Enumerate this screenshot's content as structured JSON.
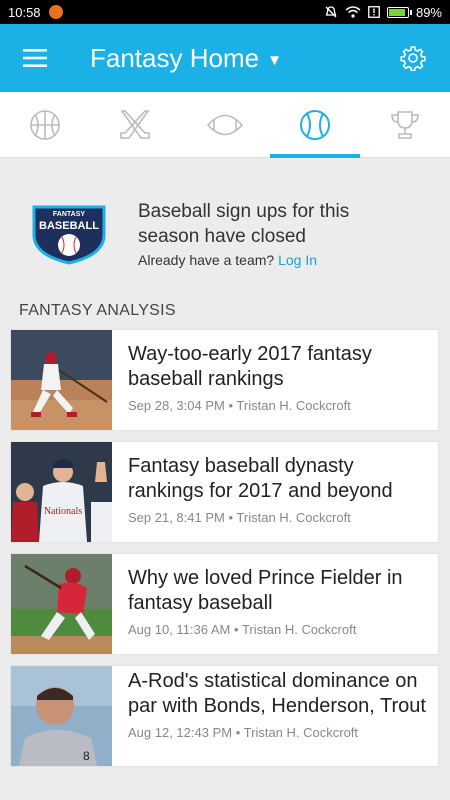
{
  "status_bar": {
    "time": "10:58",
    "battery": "89%",
    "battery_level": 0.89
  },
  "header": {
    "title": "Fantasy Home",
    "menu_icon": "hamburger-menu-icon",
    "settings_icon": "gear-icon"
  },
  "tabs": [
    {
      "icon": "basketball-icon",
      "active": false
    },
    {
      "icon": "hockey-sticks-icon",
      "active": false
    },
    {
      "icon": "football-icon",
      "active": false
    },
    {
      "icon": "baseball-icon",
      "active": true
    },
    {
      "icon": "trophy-icon",
      "active": false
    }
  ],
  "signup": {
    "logo_text_top": "FANTASY",
    "logo_text_main": "BASEBALL",
    "title": "Baseball sign ups for this season have closed",
    "subtitle": "Already have a team?",
    "login_link": "Log In"
  },
  "section_heading": "FANTASY ANALYSIS",
  "articles": [
    {
      "title": "Way-too-early 2017 fantasy baseball rankings",
      "date": "Sep 28, 3:04 PM",
      "author": "Tristan H. Cockcroft"
    },
    {
      "title": "Fantasy baseball dynasty rankings for 2017 and beyond",
      "date": "Sep 21, 8:41 PM",
      "author": "Tristan H. Cockcroft"
    },
    {
      "title": "Why we loved Prince Fielder in fantasy baseball",
      "date": "Aug 10, 11:36 AM",
      "author": "Tristan H. Cockcroft"
    },
    {
      "title": "A-Rod's statistical dominance on par with Bonds, Henderson, Trout",
      "date": "Aug 12, 12:43 PM",
      "author": "Tristan H. Cockcroft"
    }
  ],
  "meta_separator": "•",
  "colors": {
    "accent": "#1cb1e6",
    "link": "#1a9fd8",
    "background": "#ececec"
  }
}
